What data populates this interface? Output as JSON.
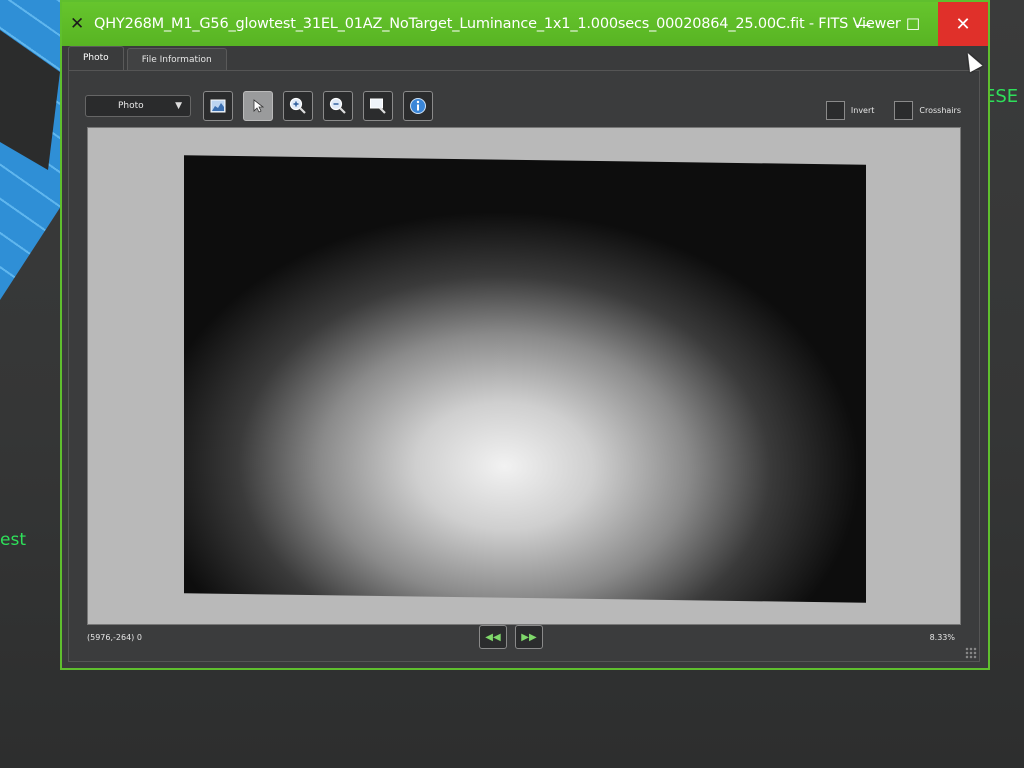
{
  "window": {
    "title": "QHY268M_M1_G56_glowtest_31EL_01AZ_NoTarget_Luminance_1x1_1.000secs_00020864_25.00C.fit - FITS Viewer",
    "app_icon": "x-logo-icon",
    "minimize": "—",
    "maximize": "☐",
    "close": "✕"
  },
  "tabs": [
    {
      "label": "Photo",
      "active": true
    },
    {
      "label": "File Information",
      "active": false
    }
  ],
  "toolbar": {
    "view_select": "Photo",
    "tools": [
      "histogram-icon",
      "pointer-icon",
      "zoom-in-icon",
      "zoom-out-icon",
      "zoom-fit-icon",
      "info-icon"
    ]
  },
  "options": {
    "invert_label": "Invert",
    "crosshairs_label": "Crosshairs"
  },
  "status": {
    "coords": "(5976,-264) 0",
    "zoom": "8.33%"
  },
  "background": {
    "left_text": "est",
    "right_text": "ESE"
  },
  "colors": {
    "titlebar": "#5bb826",
    "close": "#e0302a",
    "accent_text": "#2ee05a"
  }
}
